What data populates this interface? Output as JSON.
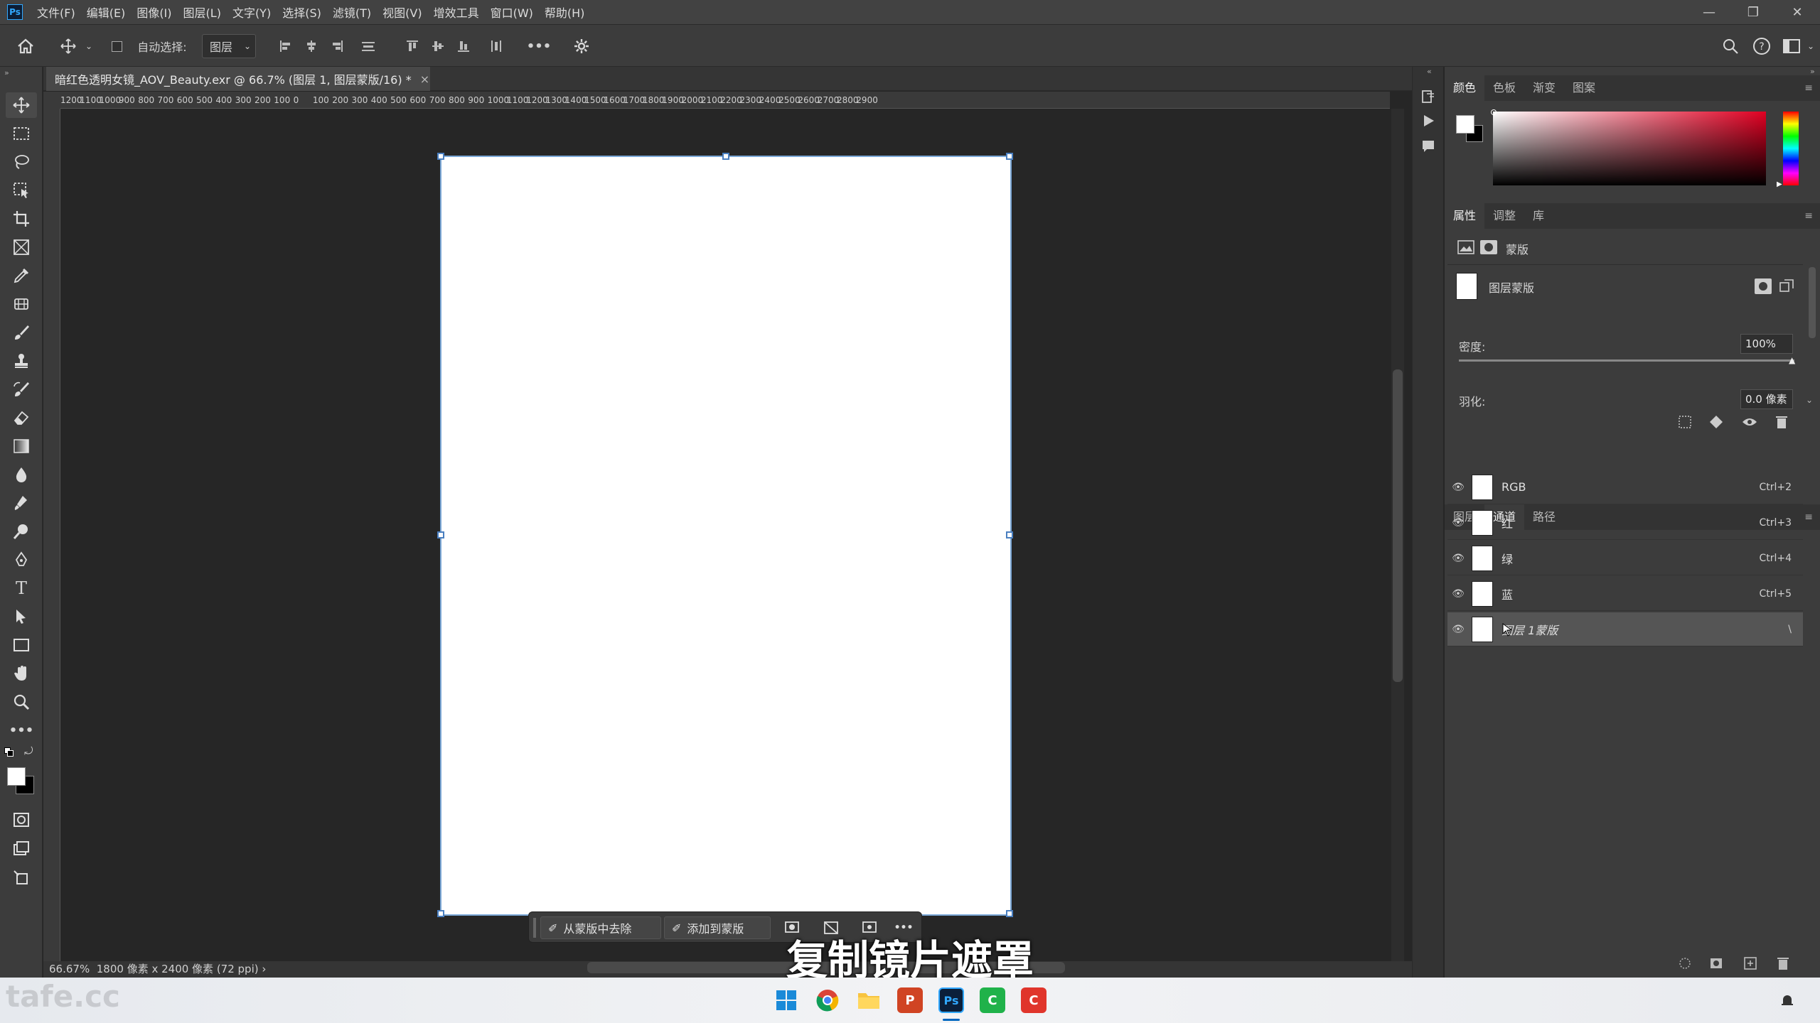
{
  "app": {
    "logo": "Ps"
  },
  "menu": [
    "文件(F)",
    "编辑(E)",
    "图像(I)",
    "图层(L)",
    "文字(Y)",
    "选择(S)",
    "滤镜(T)",
    "视图(V)",
    "增效工具",
    "窗口(W)",
    "帮助(H)"
  ],
  "window_controls": {
    "minimize": "—",
    "restore": "❐",
    "close": "✕"
  },
  "options": {
    "auto_select_label": "自动选择:",
    "auto_select_checked": false,
    "target_value": "图层"
  },
  "document": {
    "tab_title": "暗红色透明女镜_AOV_Beauty.exr @ 66.7% (图层 1, 图层蒙版/16) *",
    "close_glyph": "×"
  },
  "ruler_labels": [
    "1200",
    "1100",
    "1000",
    "900",
    "800",
    "700",
    "600",
    "500",
    "400",
    "300",
    "200",
    "100",
    "0",
    "100",
    "200",
    "300",
    "400",
    "500",
    "600",
    "700",
    "800",
    "900",
    "1000",
    "1100",
    "1200",
    "1300",
    "1400",
    "1500",
    "1600",
    "1700",
    "1800",
    "1900",
    "2000",
    "2100",
    "2200",
    "2300",
    "2400",
    "2500",
    "2600",
    "2700",
    "2800",
    "2900"
  ],
  "status": {
    "zoom": "66.67%",
    "doc_info": "1800 像素 x 2400 像素 (72 ppi)",
    "arrow": "›"
  },
  "contextual_bar": {
    "remove_label": "从蒙版中去除",
    "add_label": "添加到蒙版",
    "more": "•••"
  },
  "subtitle": "复制镜片遮罩",
  "panels": {
    "color_tabs": [
      "颜色",
      "色板",
      "渐变",
      "图案"
    ],
    "properties_tabs": [
      "属性",
      "调整",
      "库"
    ],
    "properties": {
      "mask_section_label": "蒙版",
      "layer_mask_label": "图层蒙版",
      "density_label": "密度:",
      "density_value": "100%",
      "density_fraction": 1.0,
      "feather_label": "羽化:",
      "feather_value": "0.0 像素"
    },
    "channel_tabs": [
      "图层",
      "通道",
      "路径"
    ],
    "channels": [
      {
        "name": "RGB",
        "shortcut": "Ctrl+2",
        "selected": false
      },
      {
        "name": "红",
        "shortcut": "Ctrl+3",
        "selected": false
      },
      {
        "name": "绿",
        "shortcut": "Ctrl+4",
        "selected": false
      },
      {
        "name": "蓝",
        "shortcut": "Ctrl+5",
        "selected": false
      },
      {
        "name": "图层 1蒙版",
        "shortcut": "\\",
        "selected": true
      }
    ]
  },
  "taskbar": [
    "windows-start",
    "chrome",
    "file-explorer",
    "powerpoint",
    "photoshop",
    "app-green",
    "app-red"
  ],
  "watermark": "tafe.cc",
  "colors": {
    "accent_blue": "#31a8ff",
    "foreground": "#ffffff",
    "background": "#000000",
    "picker_hue": "#e00022"
  }
}
